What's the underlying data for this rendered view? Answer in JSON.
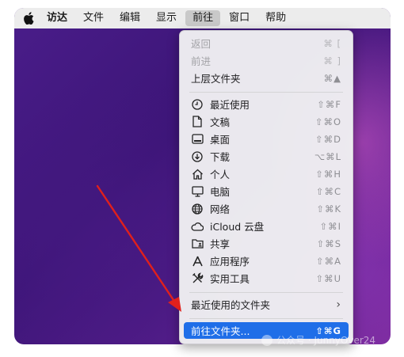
{
  "menubar": {
    "apple_icon": "apple-icon",
    "items": [
      {
        "label": "访达",
        "bold": true
      },
      {
        "label": "文件"
      },
      {
        "label": "编辑"
      },
      {
        "label": "显示"
      },
      {
        "label": "前往",
        "active": true
      },
      {
        "label": "窗口"
      },
      {
        "label": "帮助"
      }
    ]
  },
  "go_menu": {
    "back": {
      "label": "返回",
      "shortcut": "⌘ [",
      "disabled": true
    },
    "forward": {
      "label": "前进",
      "shortcut": "⌘ ]",
      "disabled": true
    },
    "enclosing": {
      "label": "上层文件夹",
      "shortcut": "⌘▲"
    },
    "locations": [
      {
        "label": "最近使用",
        "shortcut": "⇧⌘F",
        "icon": "clock-icon"
      },
      {
        "label": "文稿",
        "shortcut": "⇧⌘O",
        "icon": "document-icon"
      },
      {
        "label": "桌面",
        "shortcut": "⇧⌘D",
        "icon": "desktop-icon"
      },
      {
        "label": "下载",
        "shortcut": "⌥⌘L",
        "icon": "download-icon"
      },
      {
        "label": "个人",
        "shortcut": "⇧⌘H",
        "icon": "home-icon"
      },
      {
        "label": "电脑",
        "shortcut": "⇧⌘C",
        "icon": "computer-icon"
      },
      {
        "label": "网络",
        "shortcut": "⇧⌘K",
        "icon": "network-icon"
      },
      {
        "label": "iCloud 云盘",
        "shortcut": "⇧⌘I",
        "icon": "cloud-icon"
      },
      {
        "label": "共享",
        "shortcut": "⇧⌘S",
        "icon": "shared-folder-icon"
      },
      {
        "label": "应用程序",
        "shortcut": "⇧⌘A",
        "icon": "applications-icon"
      },
      {
        "label": "实用工具",
        "shortcut": "⇧⌘U",
        "icon": "utilities-icon"
      }
    ],
    "recent_folders": {
      "label": "最近使用的文件夹",
      "chevron": "›"
    },
    "go_to_folder": {
      "label": "前往文件夹...",
      "shortcut": "⇧⌘G",
      "highlighted": true
    }
  },
  "watermark": {
    "text": "公众号 · JunnyOver24"
  },
  "colors": {
    "highlight": "#1f6ee8",
    "annotation_arrow": "#e0201c",
    "menubar": "#ececec"
  }
}
